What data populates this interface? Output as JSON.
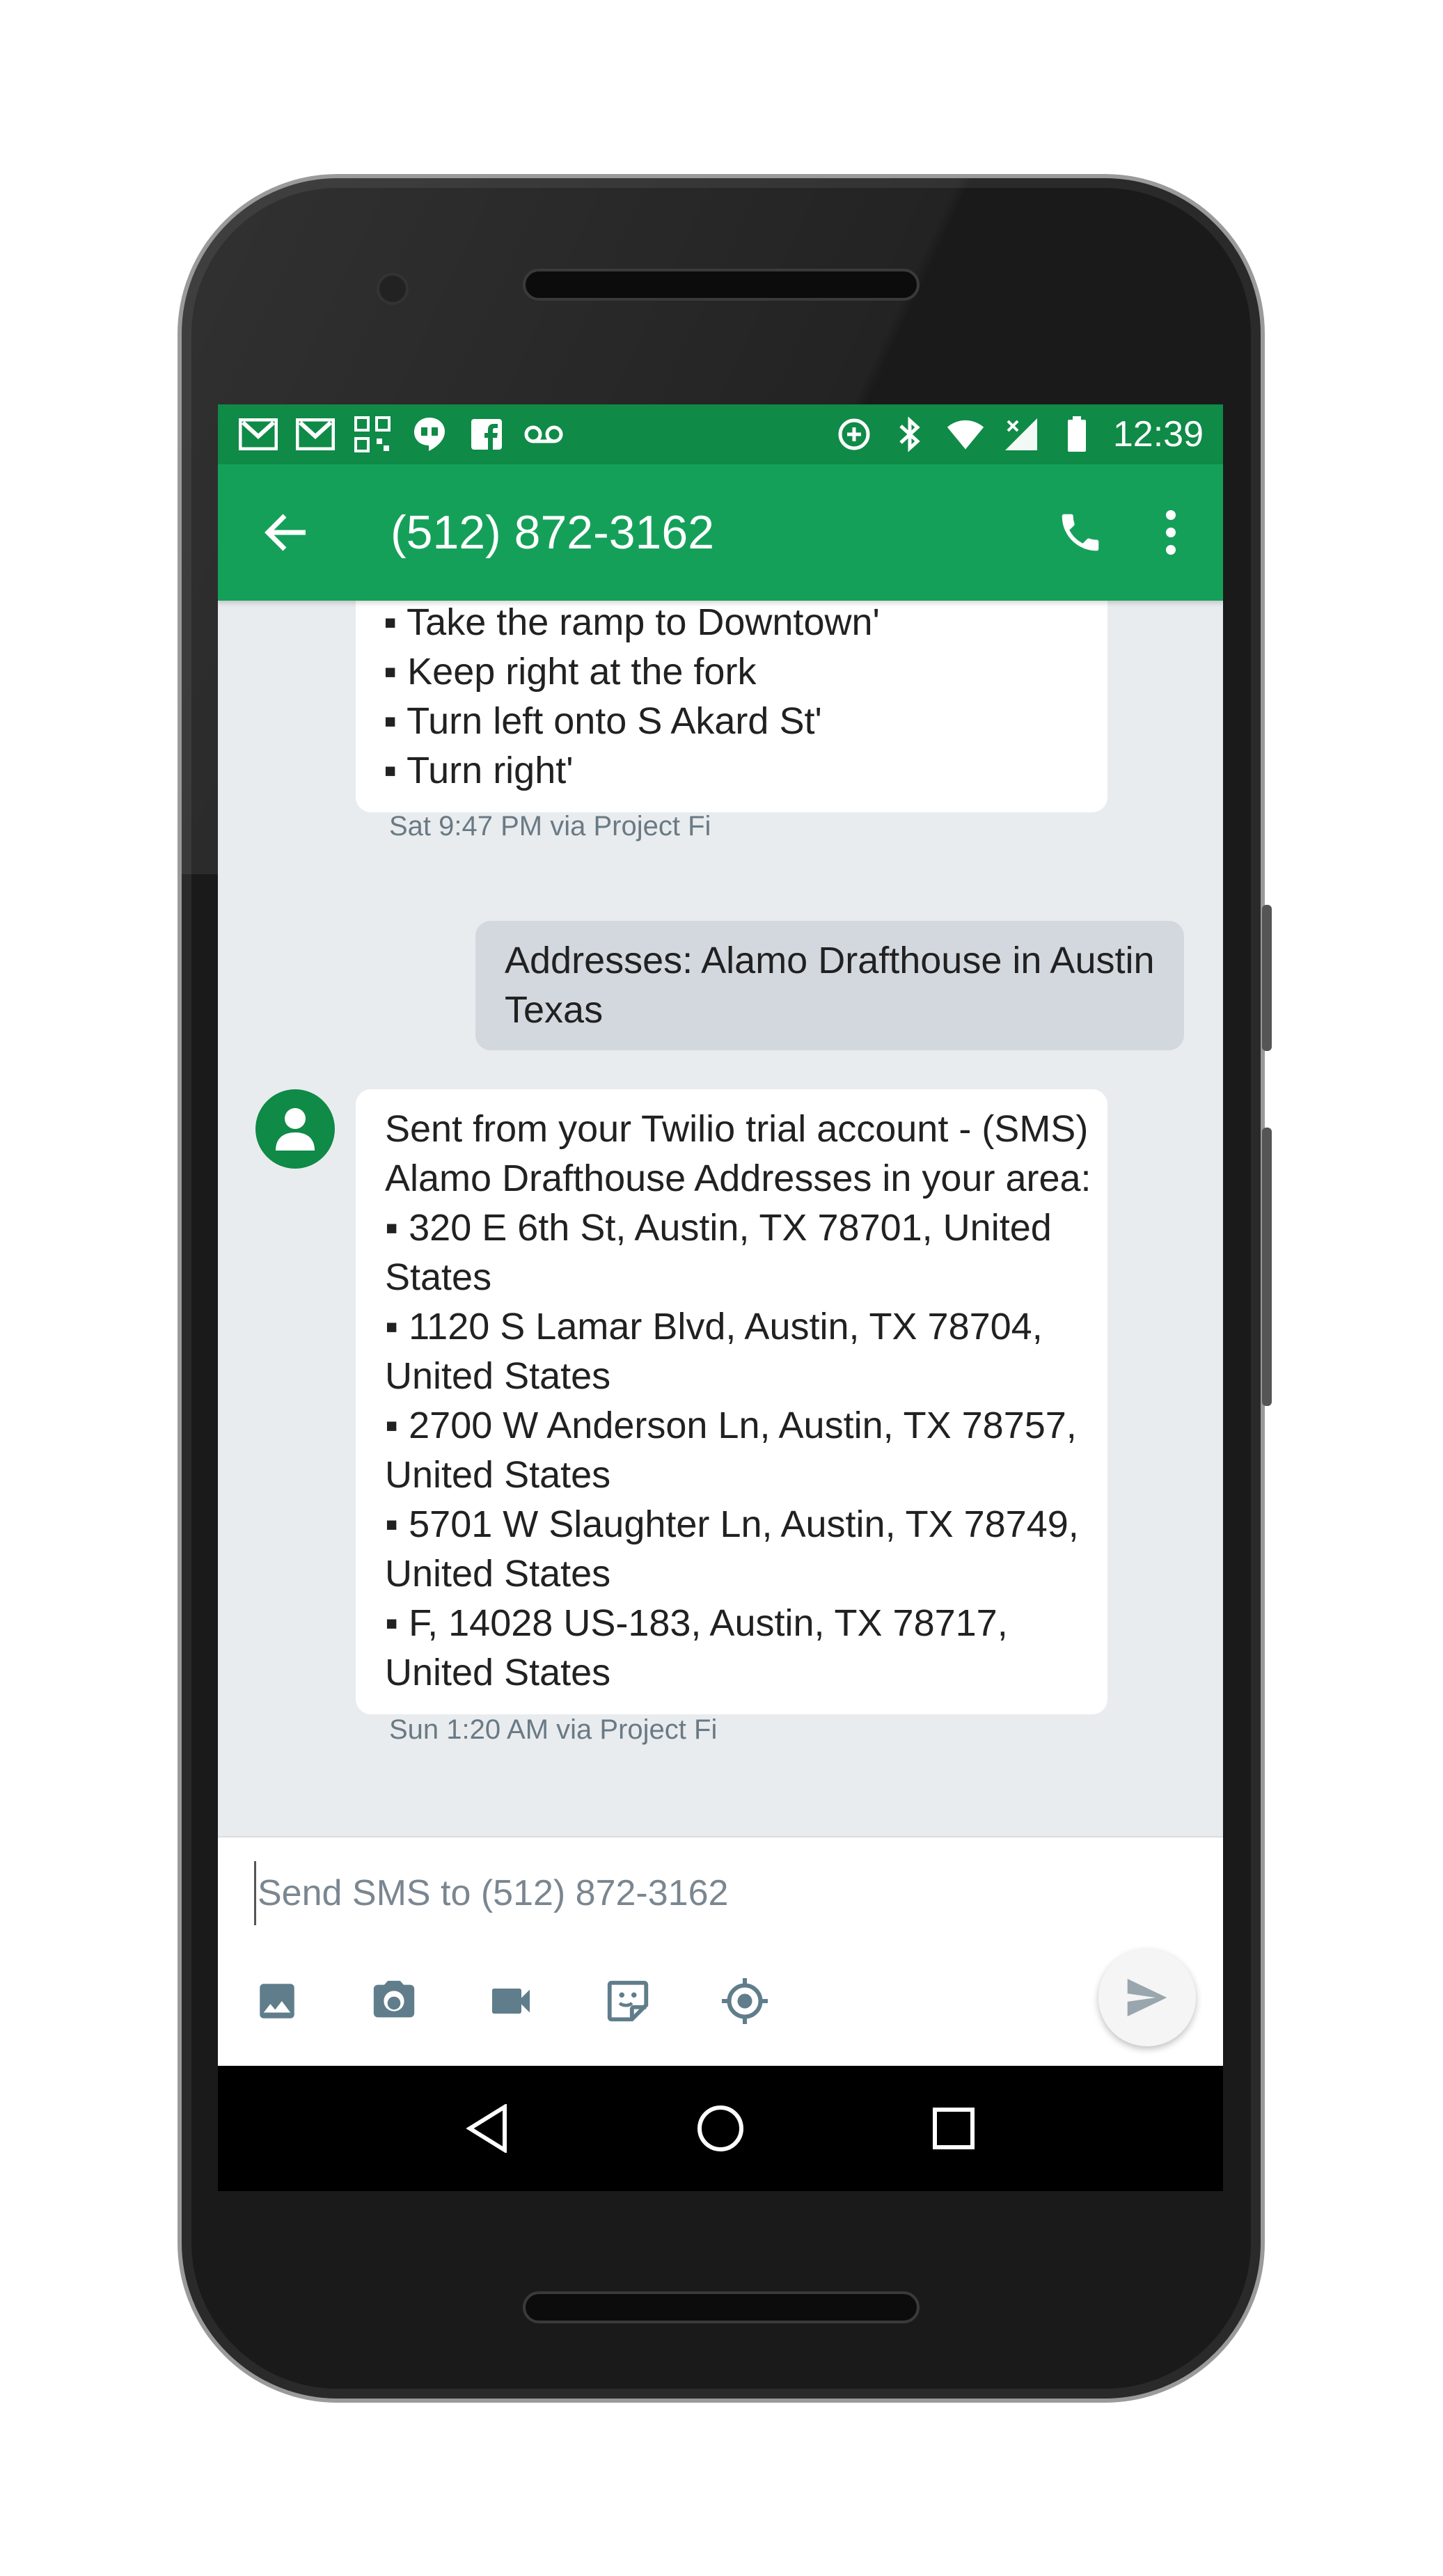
{
  "status_bar": {
    "time": "12:39",
    "left_icons": [
      "gmail-icon",
      "gmail-icon",
      "qr-code-icon",
      "hangouts-icon",
      "facebook-icon",
      "voicemail-icon"
    ],
    "right_icons": [
      "data-saver-icon",
      "bluetooth-icon",
      "wifi-icon",
      "signal-icon",
      "battery-icon"
    ]
  },
  "toolbar": {
    "title": "(512) 872-3162"
  },
  "messages": [
    {
      "direction": "incoming",
      "lines": [
        "▪ Take the ramp to Downtown'",
        "▪ Keep right at the fork",
        "▪ Turn left onto S Akard St'",
        "▪ Turn right'"
      ],
      "meta": "Sat 9:47 PM via Project Fi"
    },
    {
      "direction": "outgoing",
      "lines": [
        "Addresses: Alamo Drafthouse in Austin",
        "Texas"
      ]
    },
    {
      "direction": "incoming",
      "lines": [
        "Sent from your Twilio trial account - (SMS)",
        "Alamo Drafthouse Addresses in your area:",
        "▪ 320 E 6th St, Austin, TX 78701, United",
        "States",
        "▪ 1120 S Lamar Blvd, Austin, TX 78704,",
        "United States",
        "▪ 2700 W Anderson Ln, Austin, TX 78757,",
        "United States",
        "▪ 5701 W Slaughter Ln, Austin, TX 78749,",
        "United States",
        "▪ F, 14028 US-183, Austin, TX 78717,",
        "United States"
      ],
      "meta": "Sun 1:20 AM via Project Fi"
    }
  ],
  "composer": {
    "placeholder": "Send SMS to (512) 872-3162",
    "value": "",
    "attachments": [
      "gallery-icon",
      "camera-icon",
      "video-icon",
      "sticker-icon",
      "location-icon"
    ]
  },
  "colors": {
    "status_bar": "#0f8a47",
    "toolbar": "#15a05a",
    "background": "#e9ecef",
    "incoming_bubble": "#ffffff",
    "outgoing_bubble": "#d2d8de"
  }
}
